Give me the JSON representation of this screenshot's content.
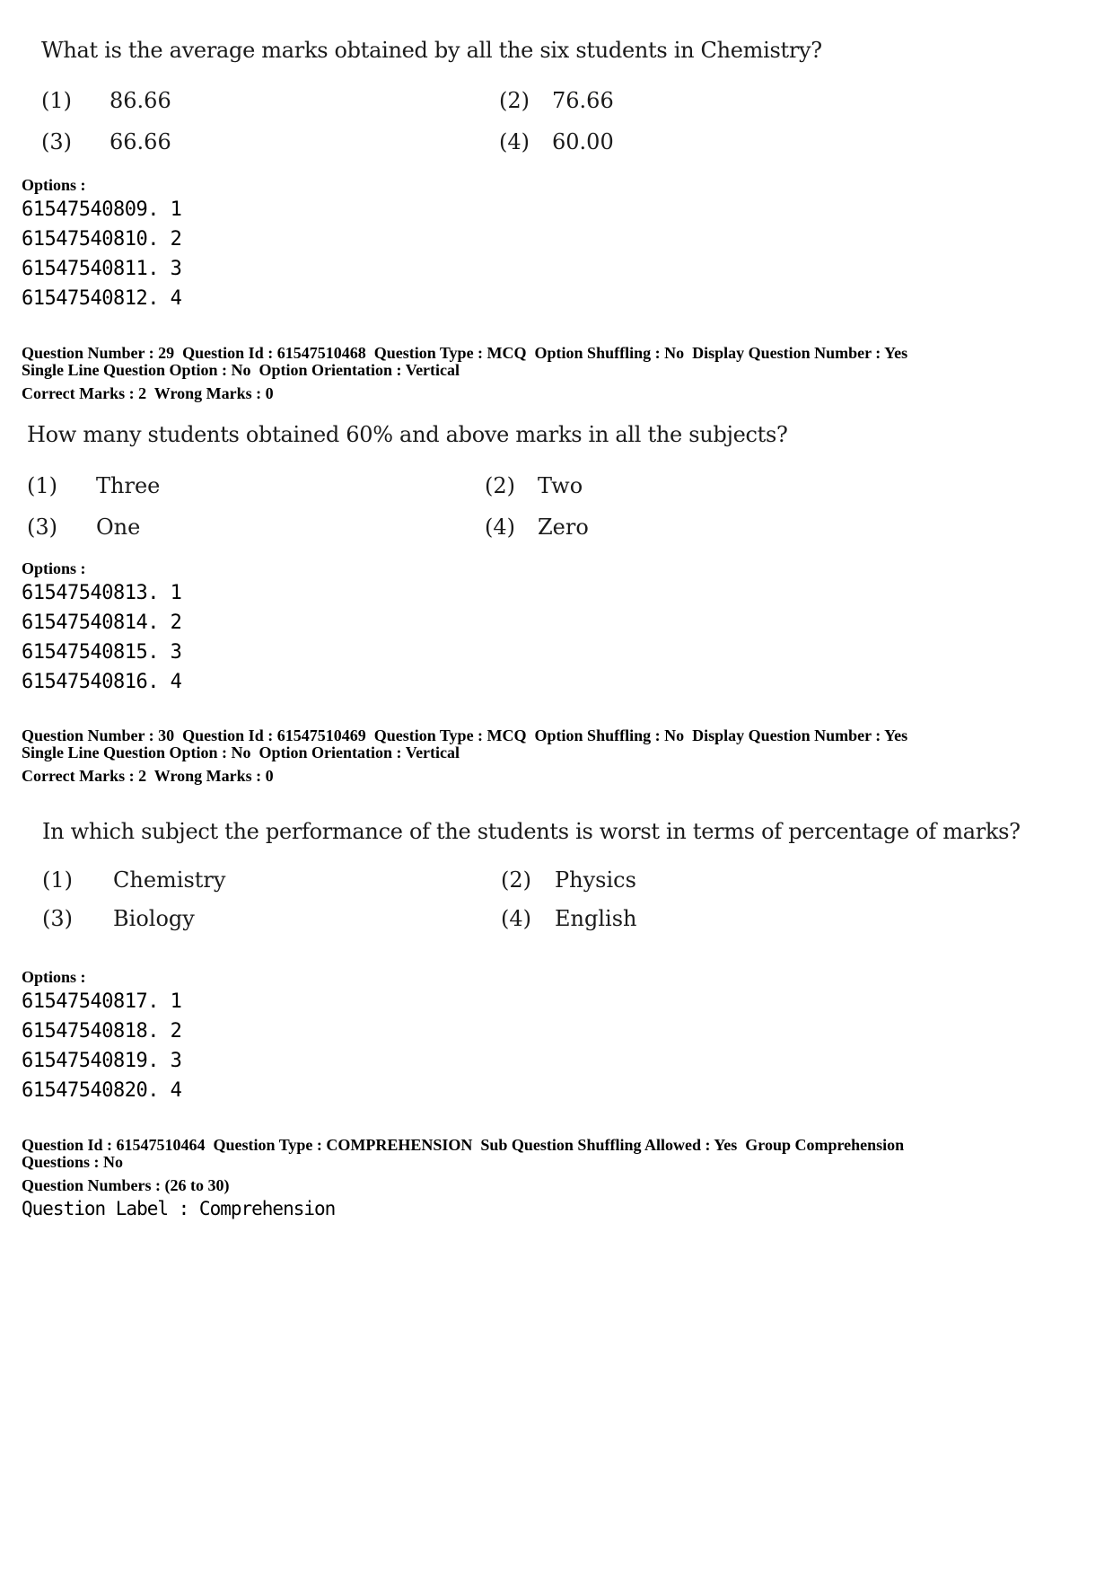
{
  "q28": {
    "question": "What is the average marks obtained by all the six students in Chemistry?",
    "choices": [
      {
        "num": "(1)",
        "text": "86.66"
      },
      {
        "num": "(2)",
        "text": "76.66"
      },
      {
        "num": "(3)",
        "text": "66.66"
      },
      {
        "num": "(4)",
        "text": "60.00"
      }
    ],
    "options_label": "Options :",
    "option_ids": [
      "61547540809. 1",
      "61547540810. 2",
      "61547540811. 3",
      "61547540812. 4"
    ]
  },
  "q29": {
    "meta_line1": "Question Number : 29  Question Id : 61547510468  Question Type : MCQ  Option Shuffling : No  Display Question Number : Yes",
    "meta_line2": "Single Line Question Option : No  Option Orientation : Vertical",
    "meta_line3": "Correct Marks : 2  Wrong Marks : 0",
    "question": "How many students obtained 60% and above marks in all the subjects?",
    "choices": [
      {
        "num": "(1)",
        "text": "Three"
      },
      {
        "num": "(2)",
        "text": "Two"
      },
      {
        "num": "(3)",
        "text": "One"
      },
      {
        "num": "(4)",
        "text": "Zero"
      }
    ],
    "options_label": "Options :",
    "option_ids": [
      "61547540813. 1",
      "61547540814. 2",
      "61547540815. 3",
      "61547540816. 4"
    ]
  },
  "q30": {
    "meta_line1": "Question Number : 30  Question Id : 61547510469  Question Type : MCQ  Option Shuffling : No  Display Question Number : Yes",
    "meta_line2": "Single Line Question Option : No  Option Orientation : Vertical",
    "meta_line3": "Correct Marks : 2  Wrong Marks : 0",
    "question": "In which subject the performance of the students is worst in terms of percentage of marks?",
    "choices": [
      {
        "num": "(1)",
        "text": "Chemistry"
      },
      {
        "num": "(2)",
        "text": "Physics"
      },
      {
        "num": "(3)",
        "text": "Biology"
      },
      {
        "num": "(4)",
        "text": "English"
      }
    ],
    "options_label": "Options :",
    "option_ids": [
      "61547540817. 1",
      "61547540818. 2",
      "61547540819. 3",
      "61547540820. 4"
    ]
  },
  "comprehension": {
    "meta_line1": "Question Id : 61547510464  Question Type : COMPREHENSION  Sub Question Shuffling Allowed : Yes  Group Comprehension",
    "meta_line2": "Questions : No",
    "meta_line3": "Question Numbers : (26 to 30)",
    "label": "Question Label : Comprehension"
  }
}
